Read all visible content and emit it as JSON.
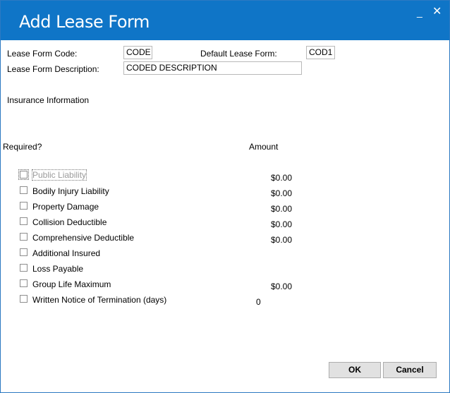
{
  "window": {
    "title": "Add Lease Form",
    "minimize_glyph": "_",
    "close_glyph": "✕"
  },
  "form": {
    "code_label": "Lease Form Code:",
    "code_value": "CODE",
    "default_label": "Default Lease Form:",
    "default_value": "COD1",
    "description_label": "Lease Form Description:",
    "description_value": "CODED DESCRIPTION"
  },
  "insurance": {
    "section_label": "Insurance Information",
    "required_header": "Required?",
    "amount_header": "Amount",
    "items": [
      {
        "label": "Public Liability",
        "amount": "$0.00",
        "checked": false,
        "disabled": true
      },
      {
        "label": "Bodily Injury Liability",
        "amount": "$0.00",
        "checked": false,
        "disabled": false
      },
      {
        "label": "Property Damage",
        "amount": "$0.00",
        "checked": false,
        "disabled": false
      },
      {
        "label": "Collision Deductible",
        "amount": "$0.00",
        "checked": false,
        "disabled": false
      },
      {
        "label": "Comprehensive Deductible",
        "amount": "$0.00",
        "checked": false,
        "disabled": false
      },
      {
        "label": "Additional Insured",
        "amount": "",
        "checked": false,
        "disabled": false
      },
      {
        "label": "Loss Payable",
        "amount": "",
        "checked": false,
        "disabled": false
      },
      {
        "label": "Group Life Maximum",
        "amount": "$0.00",
        "checked": false,
        "disabled": false
      },
      {
        "label": "Written Notice of Termination (days)",
        "amount": "0",
        "checked": false,
        "disabled": false
      }
    ]
  },
  "buttons": {
    "ok": "OK",
    "cancel": "Cancel"
  },
  "colors": {
    "titlebar": "#0f75c7",
    "disabled_text": "#9a9a9a"
  }
}
